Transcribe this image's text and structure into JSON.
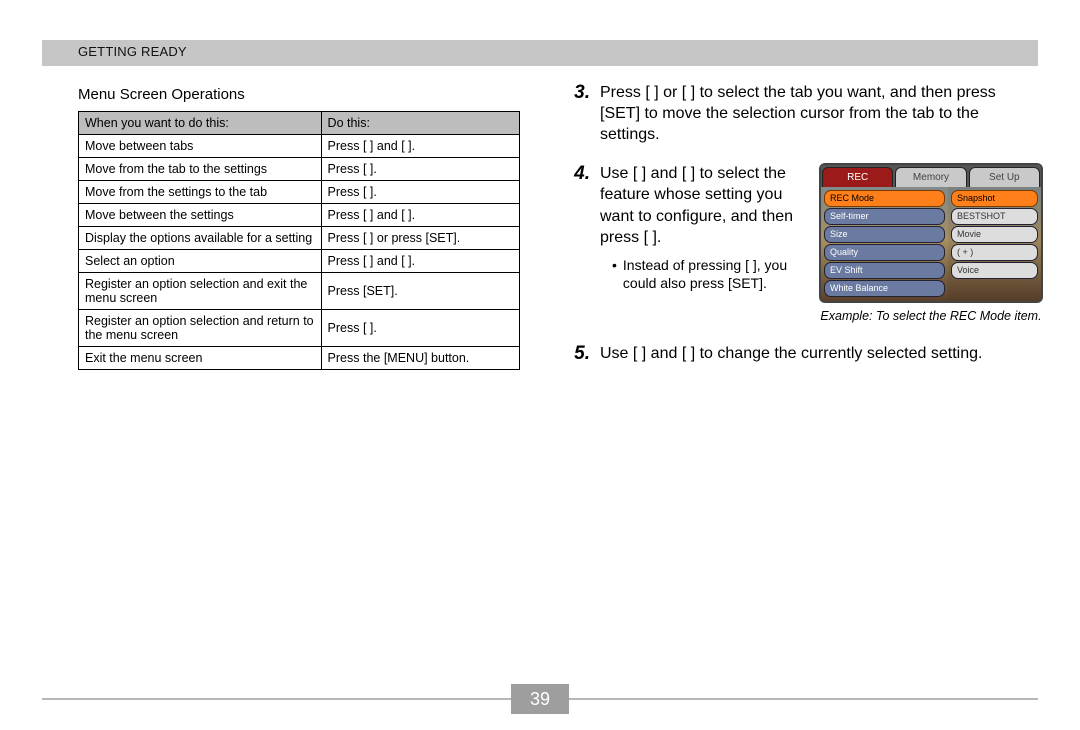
{
  "header": {
    "section": "GETTING READY"
  },
  "page_number": "39",
  "left": {
    "subheading": "Menu Screen Operations",
    "table": {
      "head1": "When you want to do this:",
      "head2": "Do this:",
      "rows": [
        {
          "action": "Move between tabs",
          "do": "Press [   ] and [   ]."
        },
        {
          "action": "Move from the tab to the settings",
          "do": "Press [   ]."
        },
        {
          "action": "Move from the settings to the tab",
          "do": "Press [   ]."
        },
        {
          "action": "Move between the settings",
          "do": "Press [   ] and [   ]."
        },
        {
          "action": "Display the options available for a setting",
          "do": "Press [   ] or press [SET]."
        },
        {
          "action": "Select an option",
          "do": "Press [   ] and [   ]."
        },
        {
          "action": "Register an option selection and exit the menu screen",
          "do": "Press [SET]."
        },
        {
          "action": "Register an option selection and return to the menu screen",
          "do": "Press [   ]."
        },
        {
          "action": "Exit the menu screen",
          "do": "Press the [MENU] button."
        }
      ]
    }
  },
  "right": {
    "step3_num": "3.",
    "step3_text": "Press [    ] or [    ] to select the tab you want, and then press [SET] to move the selection cursor from the tab to the settings.",
    "step4_num": "4.",
    "step4_text": "Use [    ] and [    ] to select the feature whose setting you want to configure, and then press [      ].",
    "step4_bullet": "Instead of pressing [    ], you could also press [SET].",
    "example_caption": "Example: To select the REC Mode item.",
    "step5_num": "5.",
    "step5_text": "Use [    ] and [    ] to change the currently selected setting.",
    "lcd": {
      "tabs": [
        "REC",
        "Memory",
        "Set Up"
      ],
      "left_items": [
        "REC Mode",
        "Self-timer",
        "Size",
        "Quality",
        "EV Shift",
        "White Balance"
      ],
      "right_items": [
        "Snapshot",
        "BESTSHOT",
        "Movie",
        "(  +  )",
        "Voice"
      ]
    }
  }
}
